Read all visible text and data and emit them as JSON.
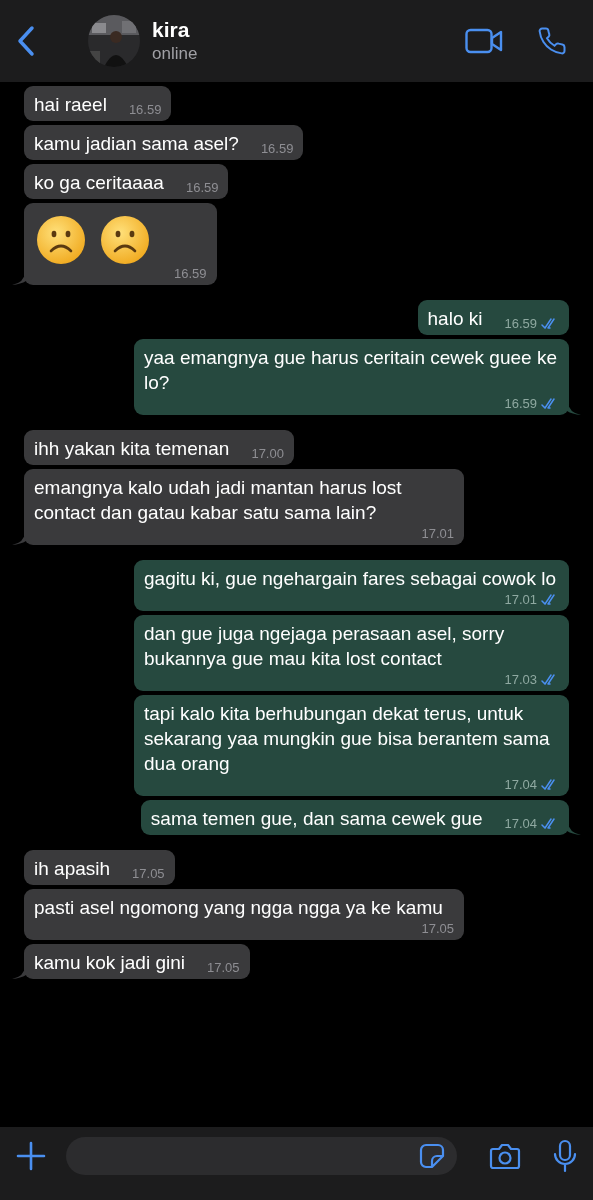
{
  "header": {
    "name": "kira",
    "status": "online"
  },
  "messages": [
    {
      "sent": false,
      "kind": "text",
      "text": "hai raeel",
      "time": "16.59",
      "tail": false
    },
    {
      "sent": false,
      "kind": "text",
      "text": "kamu jadian sama asel?",
      "time": "16.59",
      "tail": false
    },
    {
      "sent": false,
      "kind": "text",
      "text": "ko ga ceritaaaa",
      "time": "16.59",
      "tail": false
    },
    {
      "sent": false,
      "kind": "emoji",
      "faces": [
        {
          "kind": "frown"
        },
        {
          "kind": "frown"
        }
      ],
      "time": "16.59",
      "tail": true
    },
    {
      "sent": true,
      "kind": "text",
      "text": "halo ki",
      "time": "16.59",
      "tail": false,
      "read": true
    },
    {
      "sent": true,
      "kind": "text",
      "text": "yaa emangnya gue harus ceritain cewek guee ke lo?",
      "time": "16.59",
      "tail": true,
      "read": true
    },
    {
      "sent": false,
      "kind": "text",
      "text": "ihh yakan kita temenan",
      "time": "17.00",
      "tail": false
    },
    {
      "sent": false,
      "kind": "text",
      "text": "emangnya kalo udah jadi mantan harus lost contact dan gatau kabar satu sama lain?",
      "time": "17.01",
      "tail": true
    },
    {
      "sent": true,
      "kind": "text",
      "text": "gagitu ki, gue ngehargain fares sebagai cowok lo",
      "time": "17.01",
      "tail": false,
      "read": true
    },
    {
      "sent": true,
      "kind": "text",
      "text": "dan gue juga ngejaga perasaan asel, sorry bukannya gue mau kita lost contact",
      "time": "17.03",
      "tail": false,
      "read": true
    },
    {
      "sent": true,
      "kind": "text",
      "text": "tapi kalo kita berhubungan dekat terus, untuk sekarang yaa mungkin gue bisa berantem sama dua orang",
      "time": "17.04",
      "tail": false,
      "read": true
    },
    {
      "sent": true,
      "kind": "text",
      "text": "sama temen gue, dan sama cewek gue",
      "time": "17.04",
      "tail": true,
      "read": true
    },
    {
      "sent": false,
      "kind": "text",
      "text": "ih apasih",
      "time": "17.05",
      "tail": false
    },
    {
      "sent": false,
      "kind": "text",
      "text": "pasti asel ngomong yang ngga ngga ya ke kamu",
      "time": "17.05",
      "tail": false
    },
    {
      "sent": false,
      "kind": "text",
      "text": "kamu kok jadi gini",
      "time": "17.05",
      "tail": true
    }
  ]
}
